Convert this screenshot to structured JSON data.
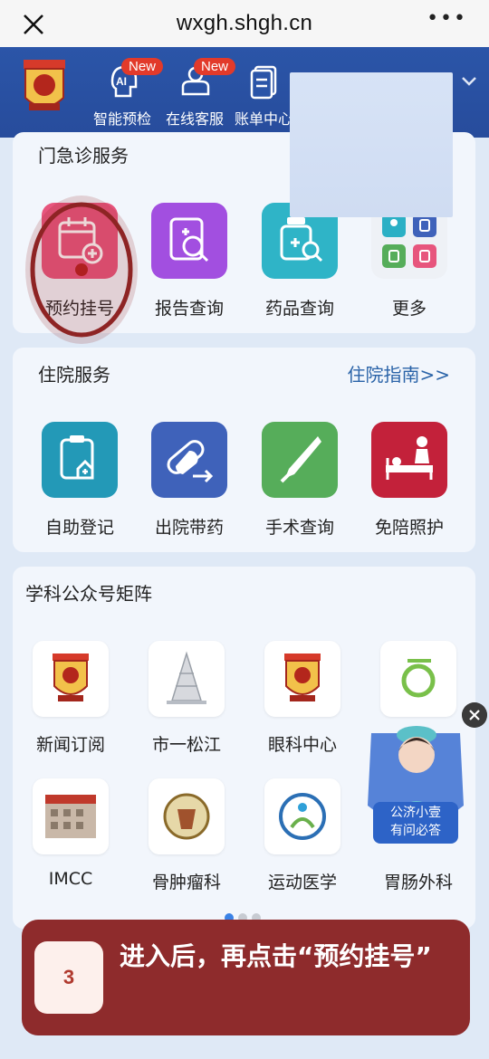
{
  "browser": {
    "url": "wxgh.shgh.cn",
    "more_label": "•••"
  },
  "header_nav": [
    {
      "label": "智能预检",
      "badge": "New"
    },
    {
      "label": "在线客服",
      "badge": "New"
    },
    {
      "label": "账单中心"
    }
  ],
  "outpatient": {
    "title": "门急诊服务",
    "items": [
      {
        "label": "预约挂号",
        "color": "#e7557d"
      },
      {
        "label": "报告查询",
        "color": "#a24fe0"
      },
      {
        "label": "药品查询",
        "color": "#2fb4c7"
      },
      {
        "label": "更多",
        "color": "#ffffff"
      }
    ]
  },
  "inpatient": {
    "title": "住院服务",
    "link": "住院指南>>",
    "items": [
      {
        "label": "自助登记",
        "color": "#2399b7"
      },
      {
        "label": "出院带药",
        "color": "#3f62ba"
      },
      {
        "label": "手术查询",
        "color": "#56ad5a"
      },
      {
        "label": "免陪照护",
        "color": "#c3213a"
      }
    ]
  },
  "matrix": {
    "title": "学科公众号矩阵",
    "row1": [
      {
        "label": "新闻订阅"
      },
      {
        "label": "市一松江"
      },
      {
        "label": "眼科中心"
      },
      {
        "label": ""
      }
    ],
    "row2": [
      {
        "label": "IMCC"
      },
      {
        "label": "骨肿瘤科"
      },
      {
        "label": "运动医学"
      },
      {
        "label": "胃肠外科"
      }
    ]
  },
  "assistant": {
    "line1": "公济小壹",
    "line2": "有问必答"
  },
  "pagination": {
    "total": 3,
    "active": 0
  },
  "tip": {
    "step": "3",
    "text": "进入后，再点击“预约挂号”"
  }
}
